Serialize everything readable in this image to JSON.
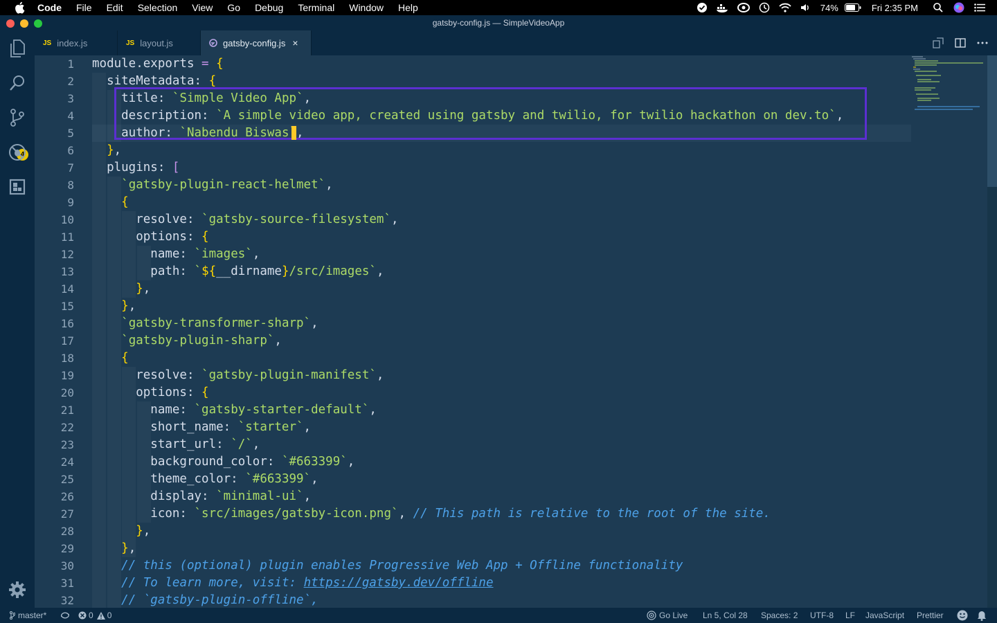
{
  "menubar": {
    "app": "Code",
    "items": [
      "File",
      "Edit",
      "Selection",
      "View",
      "Go",
      "Debug",
      "Terminal",
      "Window",
      "Help"
    ],
    "battery": "74%",
    "clock": "Fri 2:35 PM"
  },
  "window": {
    "title": "gatsby-config.js — SimpleVideoApp"
  },
  "activity": {
    "scm_badge": "4"
  },
  "tabs": [
    {
      "label": "index.js",
      "icon": "JS"
    },
    {
      "label": "layout.js",
      "icon": "JS"
    },
    {
      "label": "gatsby-config.js",
      "icon": "gatsby-icon",
      "close": "×"
    }
  ],
  "editor": {
    "lines": [
      {
        "n": "1",
        "code": "module.exports = {"
      },
      {
        "n": "2",
        "code": "  siteMetadata: {"
      },
      {
        "n": "3",
        "code": "    title: `Simple Video App`,"
      },
      {
        "n": "4",
        "code": "    description: `A simple video app, created using gatsby and twilio, for twilio hackathon on dev.to`,"
      },
      {
        "n": "5",
        "code": "    author: `Nabendu Biswas`,"
      },
      {
        "n": "6",
        "code": "  },"
      },
      {
        "n": "7",
        "code": "  plugins: ["
      },
      {
        "n": "8",
        "code": "    `gatsby-plugin-react-helmet`,"
      },
      {
        "n": "9",
        "code": "    {"
      },
      {
        "n": "10",
        "code": "      resolve: `gatsby-source-filesystem`,"
      },
      {
        "n": "11",
        "code": "      options: {"
      },
      {
        "n": "12",
        "code": "        name: `images`,"
      },
      {
        "n": "13",
        "code": "        path: `${__dirname}/src/images`,"
      },
      {
        "n": "14",
        "code": "      },"
      },
      {
        "n": "15",
        "code": "    },"
      },
      {
        "n": "16",
        "code": "    `gatsby-transformer-sharp`,"
      },
      {
        "n": "17",
        "code": "    `gatsby-plugin-sharp`,"
      },
      {
        "n": "18",
        "code": "    {"
      },
      {
        "n": "19",
        "code": "      resolve: `gatsby-plugin-manifest`,"
      },
      {
        "n": "20",
        "code": "      options: {"
      },
      {
        "n": "21",
        "code": "        name: `gatsby-starter-default`,"
      },
      {
        "n": "22",
        "code": "        short_name: `starter`,"
      },
      {
        "n": "23",
        "code": "        start_url: `/`,"
      },
      {
        "n": "24",
        "code": "        background_color: `#663399`,"
      },
      {
        "n": "25",
        "code": "        theme_color: `#663399`,"
      },
      {
        "n": "26",
        "code": "        display: `minimal-ui`,"
      },
      {
        "n": "27",
        "code": "        icon: `src/images/gatsby-icon.png`, // This path is relative to the root of the site."
      },
      {
        "n": "28",
        "code": "      },"
      },
      {
        "n": "29",
        "code": "    },"
      },
      {
        "n": "30",
        "code": "    // this (optional) plugin enables Progressive Web App + Offline functionality"
      },
      {
        "n": "31",
        "code": "    // To learn more, visit: https://gatsby.dev/offline"
      },
      {
        "n": "32",
        "code": "    // `gatsby-plugin-offline`,"
      }
    ]
  },
  "status": {
    "branch": "master*",
    "errors": "0",
    "warnings": "0",
    "golive": "Go Live",
    "position": "Ln 5, Col 28",
    "spaces": "Spaces: 2",
    "encoding": "UTF-8",
    "eol": "LF",
    "language": "JavaScript",
    "formatter": "Prettier"
  },
  "colors": {
    "bg": "#1d3b53",
    "chrome": "#0b2942",
    "highlight_box": "#5b2fd1",
    "string": "#addb67",
    "punct": "#ffd700",
    "comment": "#4da1e8"
  }
}
